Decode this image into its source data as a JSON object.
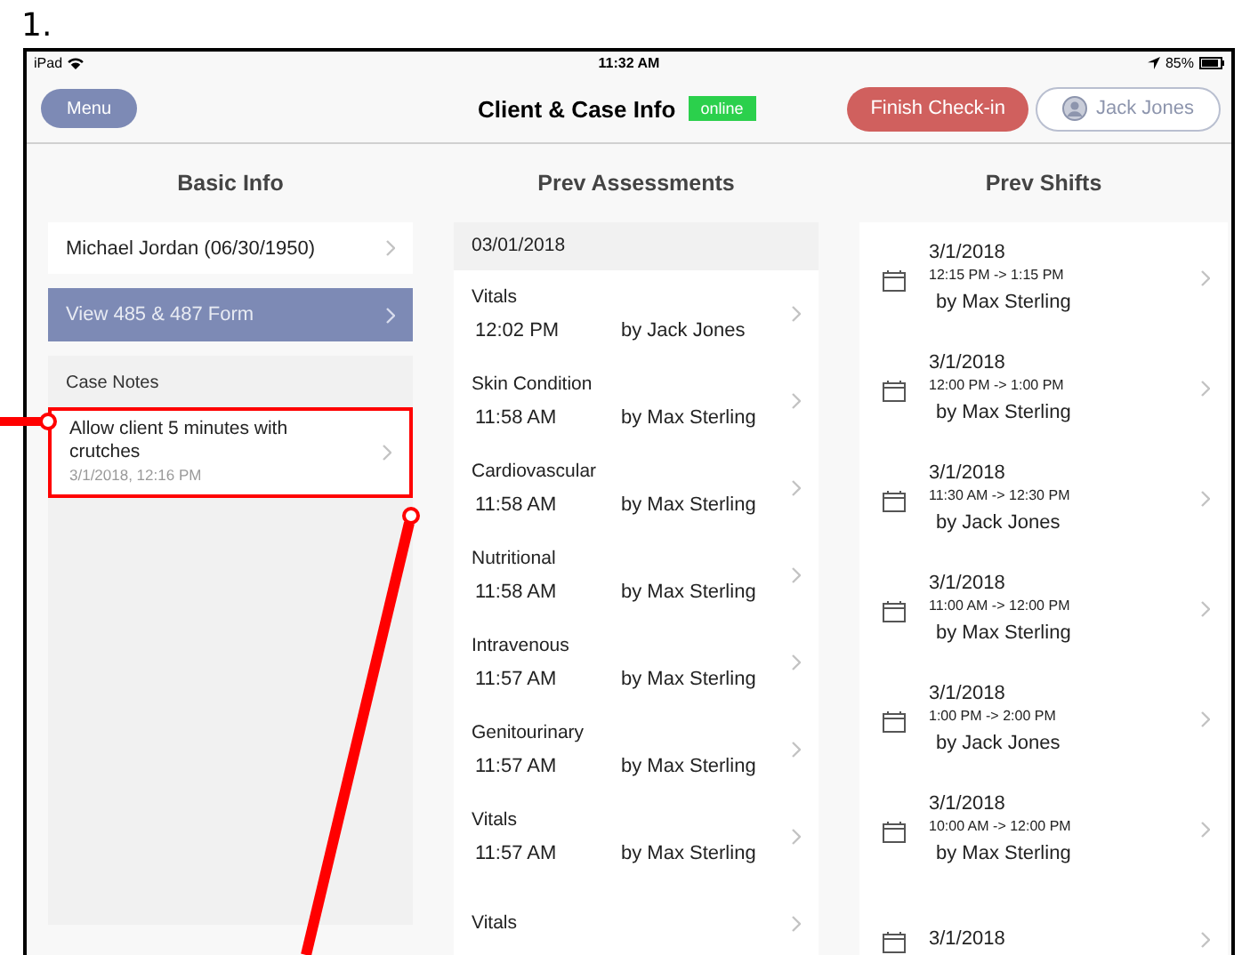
{
  "caption": "1.",
  "status_bar": {
    "device": "iPad",
    "time": "11:32 AM",
    "battery": "85%"
  },
  "nav": {
    "menu_button": "Menu",
    "title": "Client & Case Info",
    "status_badge": "online",
    "finish_button": "Finish Check-in",
    "user_button": "Jack Jones"
  },
  "columns": [
    "Basic Info",
    "Prev Assessments",
    "Prev Shifts"
  ],
  "basic_info": {
    "client": "Michael Jordan (06/30/1950)",
    "form_button": "View 485 & 487 Form",
    "case_notes_heading": "Case Notes",
    "notes": [
      {
        "text": "Allow client 5 minutes with crutches",
        "date": "3/1/2018, 12:16 PM",
        "highlighted": true
      }
    ]
  },
  "assessments": {
    "date": "03/01/2018",
    "items": [
      {
        "type": "Vitals",
        "time": "12:02 PM",
        "by": "by Jack Jones"
      },
      {
        "type": "Skin Condition",
        "time": "11:58 AM",
        "by": "by Max Sterling"
      },
      {
        "type": "Cardiovascular",
        "time": "11:58 AM",
        "by": "by Max Sterling"
      },
      {
        "type": "Nutritional",
        "time": "11:58 AM",
        "by": "by Max Sterling"
      },
      {
        "type": "Intravenous",
        "time": "11:57 AM",
        "by": "by Max Sterling"
      },
      {
        "type": "Genitourinary",
        "time": "11:57 AM",
        "by": "by Max Sterling"
      },
      {
        "type": "Vitals",
        "time": "11:57 AM",
        "by": "by Max Sterling"
      },
      {
        "type": "Vitals"
      }
    ]
  },
  "shifts": [
    {
      "date": "3/1/2018",
      "time": "12:15 PM -> 1:15 PM",
      "by": "by Max Sterling"
    },
    {
      "date": "3/1/2018",
      "time": "12:00 PM -> 1:00 PM",
      "by": "by Max Sterling"
    },
    {
      "date": "3/1/2018",
      "time": "11:30 AM -> 12:30 PM",
      "by": "by Jack Jones"
    },
    {
      "date": "3/1/2018",
      "time": "11:00 AM -> 12:00 PM",
      "by": "by Max Sterling"
    },
    {
      "date": "3/1/2018",
      "time": "1:00 PM -> 2:00 PM",
      "by": "by Jack Jones"
    },
    {
      "date": "3/1/2018",
      "time": "10:00 AM -> 12:00 PM",
      "by": "by Max Sterling"
    },
    {
      "date": "3/1/2018"
    }
  ]
}
